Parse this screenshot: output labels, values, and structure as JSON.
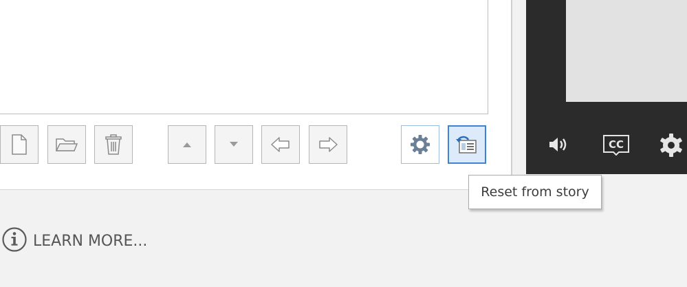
{
  "toolbar": {
    "buttons": [
      {
        "name": "new-button",
        "icon": "new-file-icon"
      },
      {
        "name": "open-button",
        "icon": "folder-icon"
      },
      {
        "name": "delete-button",
        "icon": "trash-icon"
      },
      {
        "name": "move-up-button",
        "icon": "triangle-up-icon"
      },
      {
        "name": "move-down-button",
        "icon": "triangle-down-icon"
      },
      {
        "name": "outdent-button",
        "icon": "arrow-left-icon"
      },
      {
        "name": "indent-button",
        "icon": "arrow-right-icon"
      },
      {
        "name": "settings-button",
        "icon": "gear-icon"
      },
      {
        "name": "reset-from-story-button",
        "icon": "reset-icon"
      }
    ]
  },
  "tooltip": {
    "text": "Reset from story"
  },
  "learn_more": {
    "label": "LEARN MORE..."
  },
  "player": {
    "controls": [
      {
        "name": "volume-button",
        "icon": "volume-icon"
      },
      {
        "name": "captions-button",
        "icon": "cc-icon",
        "text": "CC"
      },
      {
        "name": "player-settings-button",
        "icon": "gear-icon"
      }
    ]
  },
  "colors": {
    "accent": "#3b83d6",
    "player_bg": "#2b2b2b",
    "panel_bg": "#f2f2f2"
  }
}
